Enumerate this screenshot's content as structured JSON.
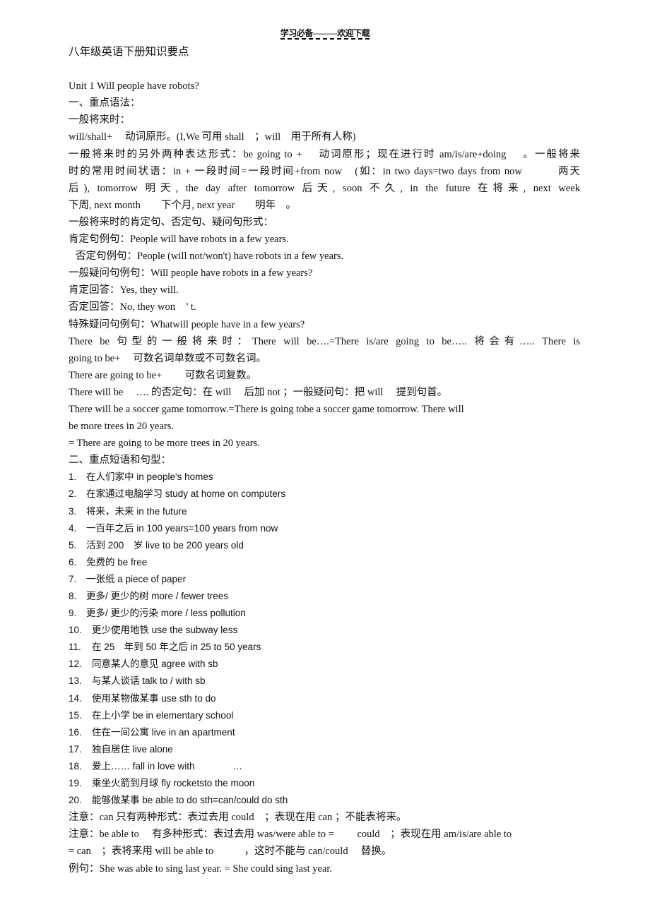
{
  "header": {
    "text": "学习必备———欢迎下载"
  },
  "document": {
    "title": "八年级英语下册知识要点",
    "unit_title": "Unit 1  Will people have robots?",
    "section1": {
      "heading": "一、重点语法：",
      "subheading": "一般将来时：",
      "lines": [
        "will/shall+　 动词原形。(I,We  可用 shall　；will　用于所有人称)",
        "一般将来时的另外两种表达形式：be going to +　 动词原形；现在进行时 am/is/are+doing　 。一般将来",
        "时的常用时间状语：in + 一段时间=一段时间+from now　(如：in two days=two days from now　　　两天",
        "后), tomorrow  明天, the day after  tomorrow  后天, soon  不久, in  the  future  在将来, next  week",
        "下周, next month　　下个月, next year　　明年　。"
      ],
      "forms_heading": "一般将来时的肯定句、否定句、疑问句形式：",
      "examples": [
        "肯定句例句：People will have robots in a few years.",
        "否定句例句：People (will not/won't) have robots in a few years.",
        "一般疑问句例句：Will people have robots in a few years?",
        "肯定回答：Yes, they will.",
        "否定回答：No, they won　’ t.",
        "特殊疑问句例句：Whatwill people have in a few years?"
      ],
      "there_be": [
        "There  be  句型的一般将来时：There  will   be….=There  is/are   going  to  be…..  将会有….. There  is",
        "going to be+　 可数名词单数或不可数名词。",
        "There are going to be+　　 可数名词复数。",
        "There will be　 …. 的否定句：在 will　 后加 not ；一般疑问句：把 will　 提到句首。",
        "There will be a soccer game tomorrow.=There is going tobe a soccer game tomorrow. There will",
        "be more trees in 20 years.",
        "= There are going to be more trees in 20 years."
      ]
    },
    "section2": {
      "heading": "二、重点短语和句型：",
      "items": [
        {
          "num": "1.",
          "text": "在人们家中 in people's homes"
        },
        {
          "num": "2.",
          "text": "在家通过电脑学习 study at home on computers"
        },
        {
          "num": "3.",
          "text": "将来，未来 in the future"
        },
        {
          "num": "4.",
          "text": "一百年之后 in 100 years=100 years from now"
        },
        {
          "num": "5.",
          "text": "活到 200　岁 live to be 200 years old"
        },
        {
          "num": "6.",
          "text": "免费的 be free"
        },
        {
          "num": "7.",
          "text": "一张纸 a piece of paper"
        },
        {
          "num": "8.",
          "text": "更多/ 更少的树 more / fewer trees"
        },
        {
          "num": "9.",
          "text": "更多/ 更少的污染 more / less pollution"
        },
        {
          "num": "10.",
          "text": "更少使用地铁 use the subway less"
        },
        {
          "num": "11.",
          "text": "在 25　年到 50  年之后 in 25 to 50 years"
        },
        {
          "num": "12.",
          "text": "同意某人的意见 agree with sb"
        },
        {
          "num": "13.",
          "text": "与某人谈话 talk to / with sb"
        },
        {
          "num": "14.",
          "text": "使用某物做某事 use sth to do"
        },
        {
          "num": "15.",
          "text": "在上小学 be in elementary school"
        },
        {
          "num": "16.",
          "text": "住在一间公寓 live in an apartment"
        },
        {
          "num": "17.",
          "text": "独自居住 live alone"
        },
        {
          "num": "18.",
          "text": "爱上…… fall in love with　　　　…"
        },
        {
          "num": "19.",
          "text": "乘坐火箭到月球 fly rocketsto the moon"
        },
        {
          "num": "20.",
          "text": "能够做某事 be able to do sth=can/could do sth"
        }
      ],
      "notes": [
        "注意：can  只有两种形式：表过去用 could　；表现在用 can ；不能表将来。",
        "注意：be  able to　 有多种形式：表过去用 was/were able to =　　 could　；表现在用 am/is/are able to",
        "= can　；表将来用 will be able to　　　，这时不能与 can/could　 替换。",
        "例句：She was able to sing last year. = She could sing last year."
      ]
    }
  }
}
